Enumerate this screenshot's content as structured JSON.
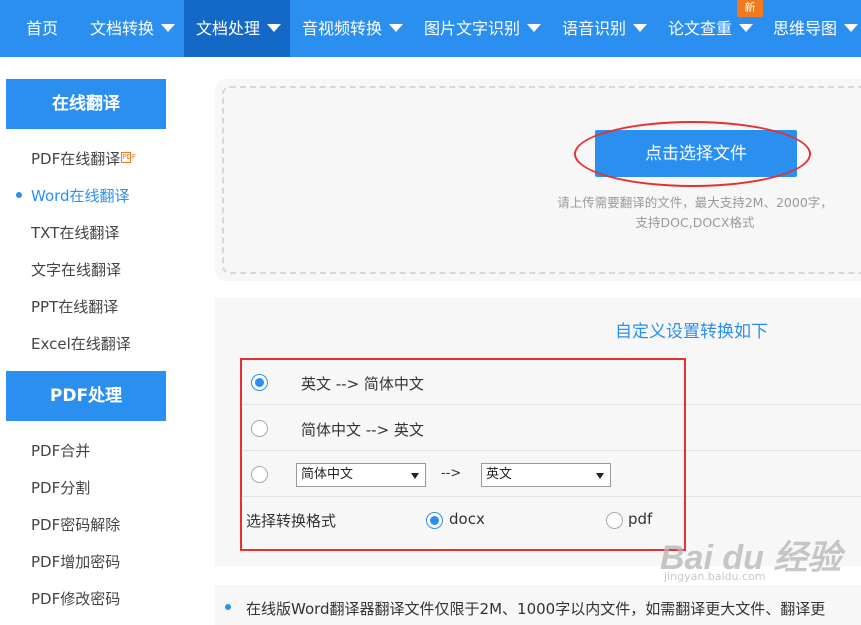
{
  "nav": {
    "items": [
      {
        "label": "首页"
      },
      {
        "label": "文档转换"
      },
      {
        "label": "文档处理"
      },
      {
        "label": "音视频转换"
      },
      {
        "label": "图片文字识别"
      },
      {
        "label": "语音识别"
      },
      {
        "label": "论文查重"
      },
      {
        "label": "思维导图"
      }
    ],
    "new_badge": "新"
  },
  "sidebar": {
    "section1_title": "在线翻译",
    "section1_items": [
      "PDF在线翻译",
      "Word在线翻译",
      "TXT在线翻译",
      "文字在线翻译",
      "PPT在线翻译",
      "Excel在线翻译"
    ],
    "pdf_mini_icon": "PDF",
    "section2_title": "PDF处理",
    "section2_items": [
      "PDF合并",
      "PDF分割",
      "PDF密码解除",
      "PDF增加密码",
      "PDF修改密码"
    ]
  },
  "upload": {
    "button_label": "点击选择文件",
    "hint_line1": "请上传需要翻译的文件，最大支持2M、2000字，",
    "hint_line2": "支持DOC,DOCX格式"
  },
  "settings": {
    "title": "自定义设置转换如下",
    "option1": "英文 --> 简体中文",
    "option2": "简体中文 --> 英文",
    "source_lang": "简体中文",
    "arrow": "-->",
    "target_lang": "英文",
    "format_label": "选择转换格式",
    "format_docx": "docx",
    "format_pdf": "pdf"
  },
  "notice": {
    "text": "在线版Word翻译器翻译文件仅限于2M、1000字以内文件，如需翻译更大文件、翻译更"
  },
  "watermark": {
    "main": "Bai du 经验",
    "sub": "jingyan.baidu.com"
  },
  "colors": {
    "accent": "#2b8ff0",
    "nav_active": "#1468c6",
    "highlight_red": "#e83030",
    "badge": "#f07a1e"
  }
}
